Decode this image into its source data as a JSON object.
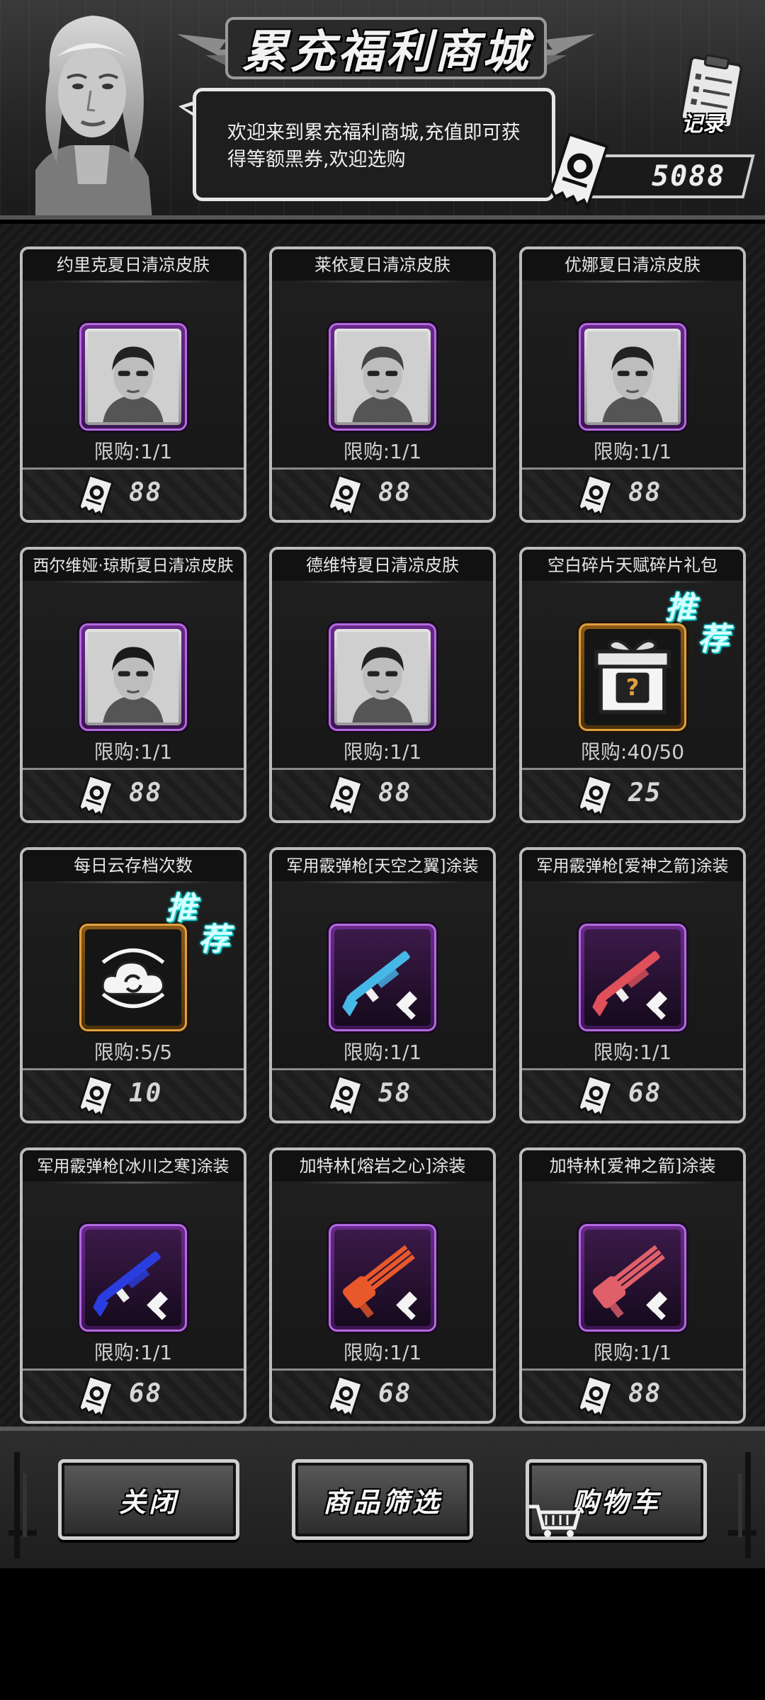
{
  "header": {
    "title": "累充福利商城",
    "speech": "欢迎来到累充福利商城,充值即可获得等额黑券,欢迎选购",
    "record_label": "记录",
    "balance": "5088"
  },
  "items": [
    {
      "title": "约里克夏日清凉皮肤",
      "limit": "限购:1/1",
      "price": "88",
      "icon": "character-portrait-icon",
      "frame": "purple",
      "recommended": false
    },
    {
      "title": "莱依夏日清凉皮肤",
      "limit": "限购:1/1",
      "price": "88",
      "icon": "character-portrait-icon",
      "frame": "purple",
      "recommended": false
    },
    {
      "title": "优娜夏日清凉皮肤",
      "limit": "限购:1/1",
      "price": "88",
      "icon": "character-portrait-icon",
      "frame": "purple",
      "recommended": false
    },
    {
      "title": "西尔维娅·琼斯夏日清凉皮肤",
      "limit": "限购:1/1",
      "price": "88",
      "icon": "character-portrait-icon",
      "frame": "purple",
      "recommended": false
    },
    {
      "title": "德维特夏日清凉皮肤",
      "limit": "限购:1/1",
      "price": "88",
      "icon": "character-portrait-icon",
      "frame": "purple",
      "recommended": false
    },
    {
      "title": "空白碎片天赋碎片礼包",
      "limit": "限购:40/50",
      "price": "25",
      "icon": "gift-box-icon",
      "frame": "gold",
      "recommended": true
    },
    {
      "title": "每日云存档次数",
      "limit": "限购:5/5",
      "price": "10",
      "icon": "cloud-sync-icon",
      "frame": "gold",
      "recommended": true
    },
    {
      "title": "军用霰弹枪[天空之翼]涂装",
      "limit": "限购:1/1",
      "price": "58",
      "icon": "shotgun-skin-icon",
      "frame": "purple",
      "recommended": false,
      "color": "#46b8e8"
    },
    {
      "title": "军用霰弹枪[爱神之箭]涂装",
      "limit": "限购:1/1",
      "price": "68",
      "icon": "shotgun-skin-icon",
      "frame": "purple",
      "recommended": false,
      "color": "#e0505a"
    },
    {
      "title": "军用霰弹枪[冰川之寒]涂装",
      "limit": "限购:1/1",
      "price": "68",
      "icon": "shotgun-skin-icon",
      "frame": "purple",
      "recommended": false,
      "color": "#2a3ee0"
    },
    {
      "title": "加特林[熔岩之心]涂装",
      "limit": "限购:1/1",
      "price": "68",
      "icon": "gatling-skin-icon",
      "frame": "purple",
      "recommended": false,
      "color": "#e8582a"
    },
    {
      "title": "加特林[爱神之箭]涂装",
      "limit": "限购:1/1",
      "price": "88",
      "icon": "gatling-skin-icon",
      "frame": "purple",
      "recommended": false,
      "color": "#e0606a"
    }
  ],
  "recommend_badge": {
    "char1": "推",
    "char2": "荐"
  },
  "bottom": {
    "close_label": "关闭",
    "filter_label": "商品筛选",
    "cart_label": "购物车"
  }
}
